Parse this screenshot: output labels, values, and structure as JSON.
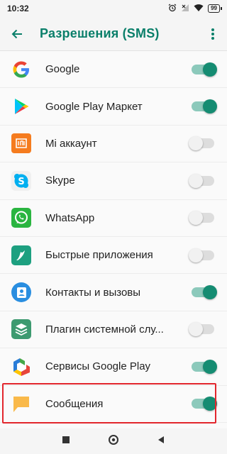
{
  "status": {
    "time": "10:32",
    "battery": "99"
  },
  "appbar": {
    "title": "Разрешения (SMS)"
  },
  "colors": {
    "accent": "#0a7f6a",
    "toggle_on": "#158c72",
    "highlight": "#e2262d"
  },
  "apps": [
    {
      "label": "Google",
      "icon": "google-icon",
      "enabled": true
    },
    {
      "label": "Google Play Маркет",
      "icon": "google-play-icon",
      "enabled": true
    },
    {
      "label": "Mi аккаунт",
      "icon": "mi-account-icon",
      "enabled": false
    },
    {
      "label": "Skype",
      "icon": "skype-icon",
      "enabled": false
    },
    {
      "label": "WhatsApp",
      "icon": "whatsapp-icon",
      "enabled": false
    },
    {
      "label": "Быстрые приложения",
      "icon": "quick-apps-icon",
      "enabled": false
    },
    {
      "label": "Контакты и вызовы",
      "icon": "contacts-icon",
      "enabled": true
    },
    {
      "label": "Плагин системной слу...",
      "icon": "system-plugin-icon",
      "enabled": false
    },
    {
      "label": "Сервисы Google Play",
      "icon": "google-play-services-icon",
      "enabled": true
    },
    {
      "label": "Сообщения",
      "icon": "messages-icon",
      "enabled": true
    }
  ]
}
